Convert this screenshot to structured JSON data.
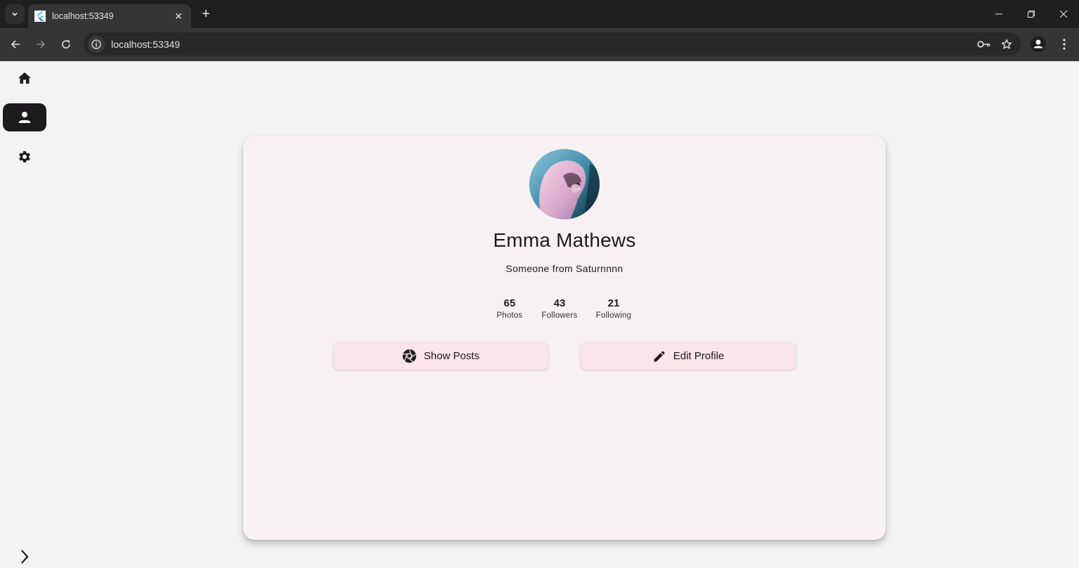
{
  "browser": {
    "tab_title": "localhost:53349",
    "url": "localhost:53349",
    "icons": {
      "tab_search": "chevron-down-icon",
      "favicon": "flutter-icon",
      "tab_close": "close-icon",
      "new_tab": "plus-icon",
      "back": "arrow-left-icon",
      "forward": "arrow-right-icon",
      "reload": "reload-icon",
      "site_info": "info-icon",
      "passwords": "key-icon",
      "bookmark": "star-icon",
      "profile": "account-icon",
      "menu": "kebab-menu-icon",
      "minimize": "minimize-icon",
      "restore": "restore-icon",
      "close_window": "close-icon"
    },
    "tab_close_glyph": "✕",
    "new_tab_glyph": "+"
  },
  "rail": {
    "items": [
      {
        "name": "home",
        "icon": "home-icon",
        "active": false
      },
      {
        "name": "profile",
        "icon": "person-icon",
        "active": true
      },
      {
        "name": "settings",
        "icon": "gear-icon",
        "active": false
      }
    ],
    "expand_icon": "chevron-right-icon"
  },
  "profile": {
    "name": "Emma Mathews",
    "bio": "Someone from Saturnnnn",
    "stats": [
      {
        "value": "65",
        "label": "Photos"
      },
      {
        "value": "43",
        "label": "Followers"
      },
      {
        "value": "21",
        "label": "Following"
      }
    ],
    "buttons": [
      {
        "label": "Show Posts",
        "icon": "camera-shutter-icon"
      },
      {
        "label": "Edit Profile",
        "icon": "pencil-icon"
      }
    ]
  },
  "colors": {
    "card_bg": "#f7f1f3",
    "button_bg": "#fbe4ea",
    "rail_active": "#1d1b1e",
    "page_bg": "#f3f3f3"
  }
}
